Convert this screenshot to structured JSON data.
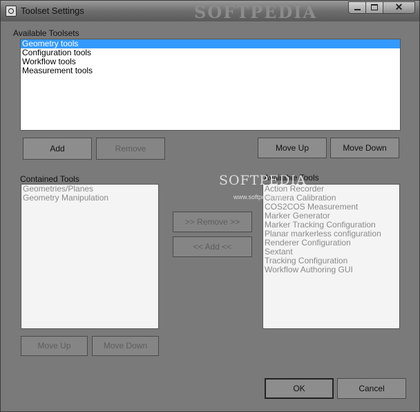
{
  "window": {
    "title": "Toolset Settings",
    "watermark": "SOFTPEDIA",
    "controls": {
      "minimize": "minimize",
      "maximize": "maximize",
      "close": "✕"
    }
  },
  "available_toolsets": {
    "label": "Available Toolsets",
    "items": [
      "Geometry tools",
      "Configuration tools",
      "Workflow tools",
      "Measurement tools"
    ],
    "selected_index": 0,
    "buttons": {
      "add": "Add",
      "remove": "Remove",
      "move_up": "Move Up",
      "move_down": "Move Down"
    }
  },
  "contained_tools": {
    "label": "Contained Tools",
    "items": [
      "Geometries/Planes",
      "Geometry Manipulation"
    ],
    "buttons": {
      "move_up": "Move Up",
      "move_down": "Move Down"
    }
  },
  "transfer_buttons": {
    "remove": ">> Remove >>",
    "add": "<< Add <<"
  },
  "available_tools": {
    "label": "Available Tools",
    "items": [
      "Action Recorder",
      "Camera Calibration",
      "COS2COS Measurement",
      "Marker Generator",
      "Marker Tracking Configuration",
      "Planar markerless configuration",
      "Renderer Configuration",
      "Sextant",
      "Tracking Configuration",
      "Workflow Authoring GUI"
    ]
  },
  "dialog_buttons": {
    "ok": "OK",
    "cancel": "Cancel"
  },
  "overlay": {
    "watermark": "SOFTPEDIA",
    "watermark_url": "www.softpedia.com"
  }
}
